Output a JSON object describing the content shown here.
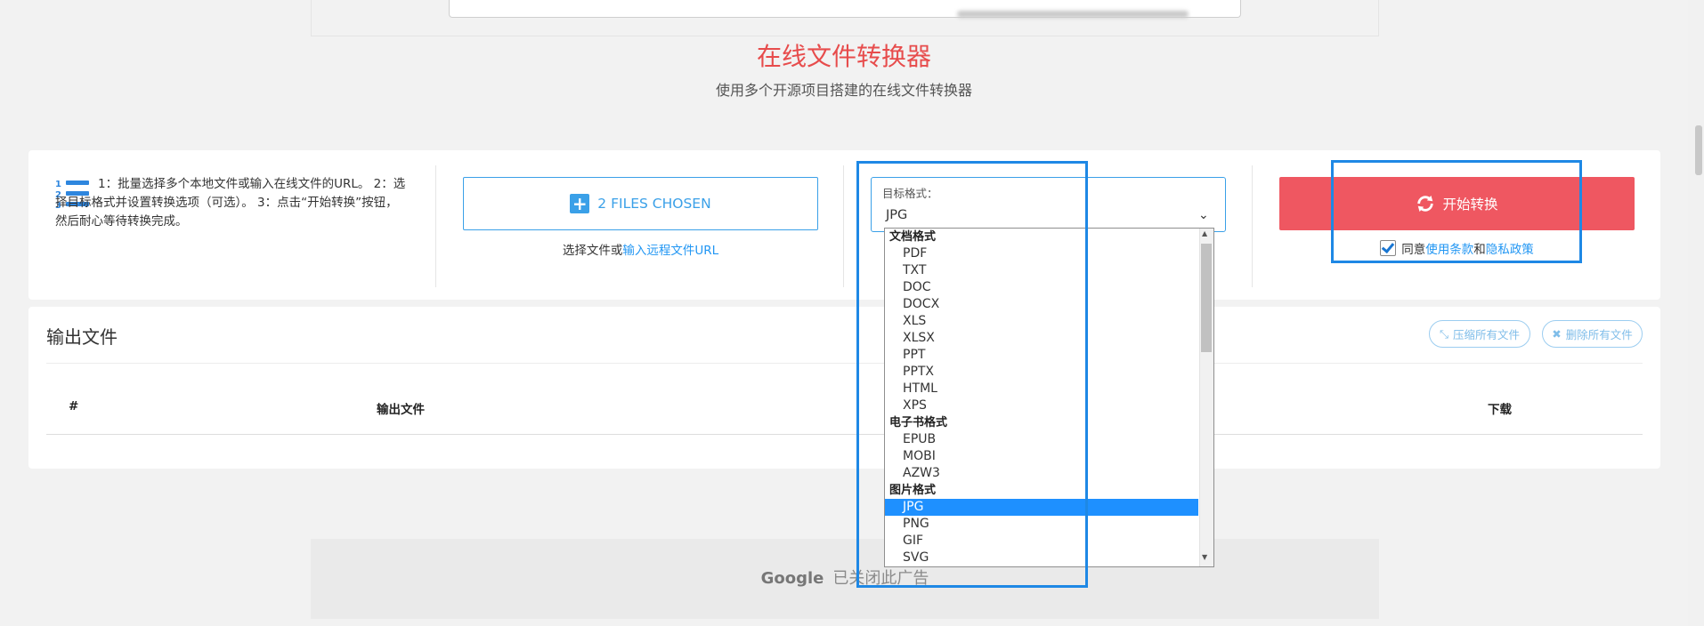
{
  "header": {
    "title": "在线文件转换器",
    "subtitle": "使用多个开源项目搭建的在线文件转换器"
  },
  "instructions": {
    "text": "1：批量选择多个本地文件或输入在线文件的URL。 2：选择目标格式并设置转换选项（可选）。 3：点击“开始转换”按钮，然后耐心等待转换完成。",
    "icon": "numbered-list-icon"
  },
  "file_picker": {
    "button_label": "2 FILES CHOSEN",
    "hint_prefix": "选择文件或",
    "hint_link": "输入远程文件URL"
  },
  "target_format": {
    "label": "目标格式：",
    "selected": "JPG",
    "groups": [
      {
        "label": "文档格式",
        "options": [
          "PDF",
          "TXT",
          "DOC",
          "DOCX",
          "XLS",
          "XLSX",
          "PPT",
          "PPTX",
          "HTML",
          "XPS"
        ]
      },
      {
        "label": "电子书格式",
        "options": [
          "EPUB",
          "MOBI",
          "AZW3"
        ]
      },
      {
        "label": "图片格式",
        "options": [
          "JPG",
          "PNG",
          "GIF",
          "SVG"
        ]
      }
    ]
  },
  "convert": {
    "button_label": "开始转换",
    "agree_prefix": "同意",
    "terms_link": "使用条款",
    "and_text": "和",
    "privacy_link": "隐私政策",
    "agreed": true
  },
  "output": {
    "title": "输出文件",
    "compress_all": "压缩所有文件",
    "delete_all": "删除所有文件",
    "columns": {
      "index": "#",
      "file": "输出文件",
      "download": "下载"
    }
  },
  "ad": {
    "brand": "Google",
    "text": "已关闭此广告"
  },
  "colors": {
    "accent_blue": "#3aa0e8",
    "title_red": "#e74c4c",
    "convert_red": "#ef5761",
    "highlight": "#1e88e5",
    "selected_option": "#1e90ff"
  }
}
